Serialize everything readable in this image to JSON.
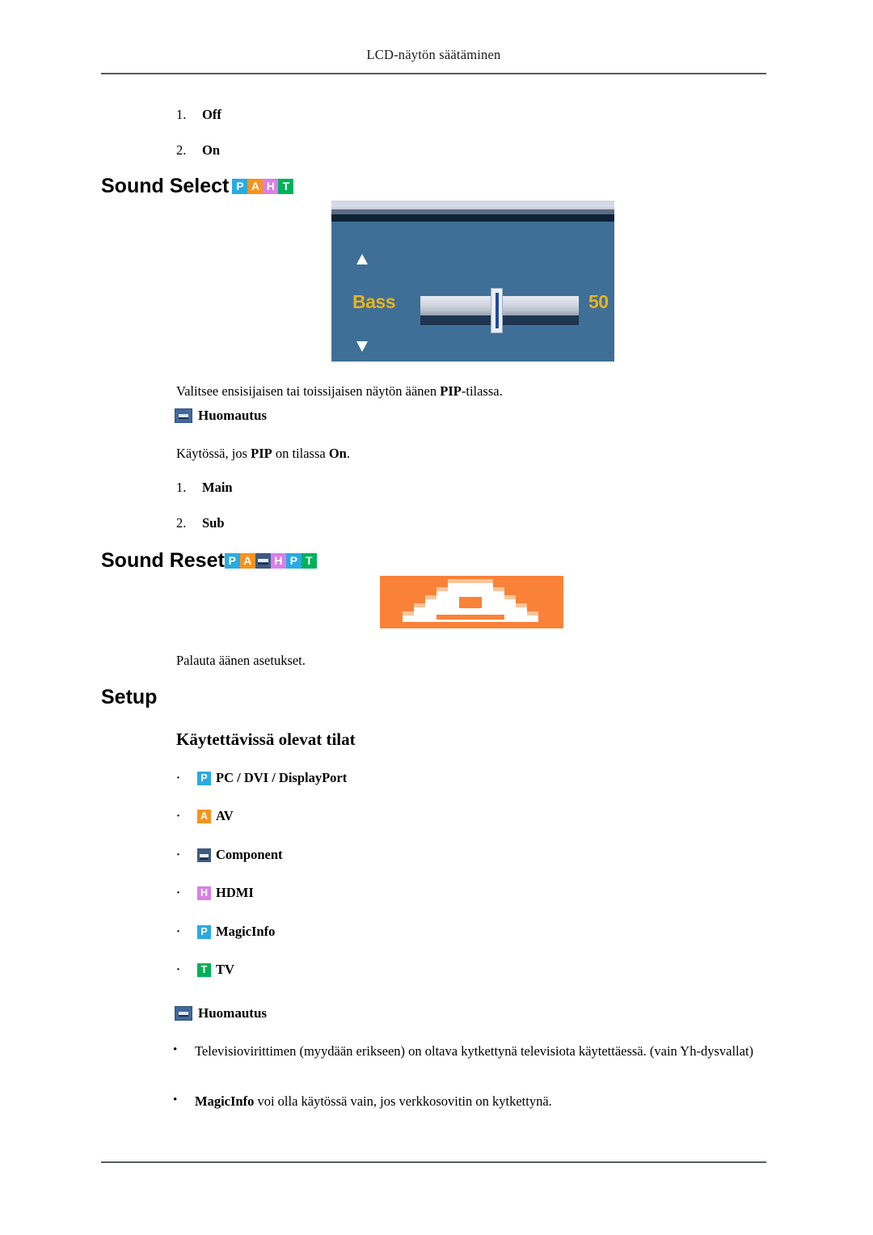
{
  "page": {
    "header_title": "LCD-näytön säätäminen"
  },
  "top_list": [
    {
      "num": "1.",
      "label": "Off"
    },
    {
      "num": "2.",
      "label": "On"
    }
  ],
  "sound_select": {
    "heading": "Sound Select",
    "badges": [
      {
        "icon": "badge-p-icon",
        "letter": "P",
        "color": "#29abe2"
      },
      {
        "icon": "badge-a-icon",
        "letter": "A",
        "color": "#f7931e"
      },
      {
        "icon": "badge-h-icon",
        "letter": "H",
        "color": "#d97fe8"
      },
      {
        "icon": "badge-t-icon",
        "letter": "T",
        "color": "#00b15a"
      }
    ],
    "osd": {
      "label": "Bass",
      "value": "50",
      "up_arrow": "arrow-up-icon",
      "down_arrow": "arrow-down-icon",
      "panel_color": "#3f6f96",
      "text_color": "#e8b21e"
    },
    "description_prefix": "Valitsee ensisijaisen tai toissijaisen näytön äänen ",
    "description_bold": "PIP",
    "description_suffix": "-tilassa.",
    "note_label": "Huomautus",
    "note_prefix": "Käytössä, jos ",
    "note_bold_1": "PIP",
    "note_middle": " on tilassa ",
    "note_bold_2": "On",
    "note_suffix": ".",
    "options": [
      {
        "num": "1.",
        "label": "Main"
      },
      {
        "num": "2.",
        "label": "Sub"
      }
    ]
  },
  "sound_reset": {
    "heading": "Sound Reset",
    "badges": [
      {
        "icon": "badge-p-icon",
        "letter": "P",
        "color": "#29abe2"
      },
      {
        "icon": "badge-a-icon",
        "letter": "A",
        "color": "#f7931e"
      },
      {
        "icon": "badge-component-icon",
        "letter": "",
        "color": "#3d5a80"
      },
      {
        "icon": "badge-h-icon",
        "letter": "H",
        "color": "#d97fe8"
      },
      {
        "icon": "badge-p-icon",
        "letter": "P",
        "color": "#29abe2"
      },
      {
        "icon": "badge-t-icon",
        "letter": "T",
        "color": "#00b15a"
      }
    ],
    "image_alt": "AV",
    "image_color": "#fa8238",
    "description": "Palauta äänen asetukset."
  },
  "setup": {
    "heading": "Setup",
    "subheading": "Käytettävissä olevat tilat",
    "modes": [
      {
        "badge": "badge-p-icon",
        "letter": "P",
        "label": "PC / DVI / DisplayPort"
      },
      {
        "badge": "badge-a-icon",
        "letter": "A",
        "label": "AV"
      },
      {
        "badge": "badge-component-icon",
        "letter": "",
        "label": "Component"
      },
      {
        "badge": "badge-h-icon",
        "letter": "H",
        "label": "HDMI"
      },
      {
        "badge": "badge-p-icon",
        "letter": "P",
        "label": "MagicInfo"
      },
      {
        "badge": "badge-t-icon",
        "letter": "T",
        "label": "TV"
      }
    ],
    "note_label": "Huomautus",
    "notes": [
      {
        "bullet": "•",
        "bold": "",
        "text": "Televisiovirittimen (myydään erikseen) on oltava kytkettynä televisiota käytettäessä. (vain Yh-dysvallat)"
      },
      {
        "bullet": "•",
        "bold": "MagicInfo",
        "text": " voi olla käytössä vain, jos verkkosovitin on kytkettynä."
      }
    ]
  }
}
